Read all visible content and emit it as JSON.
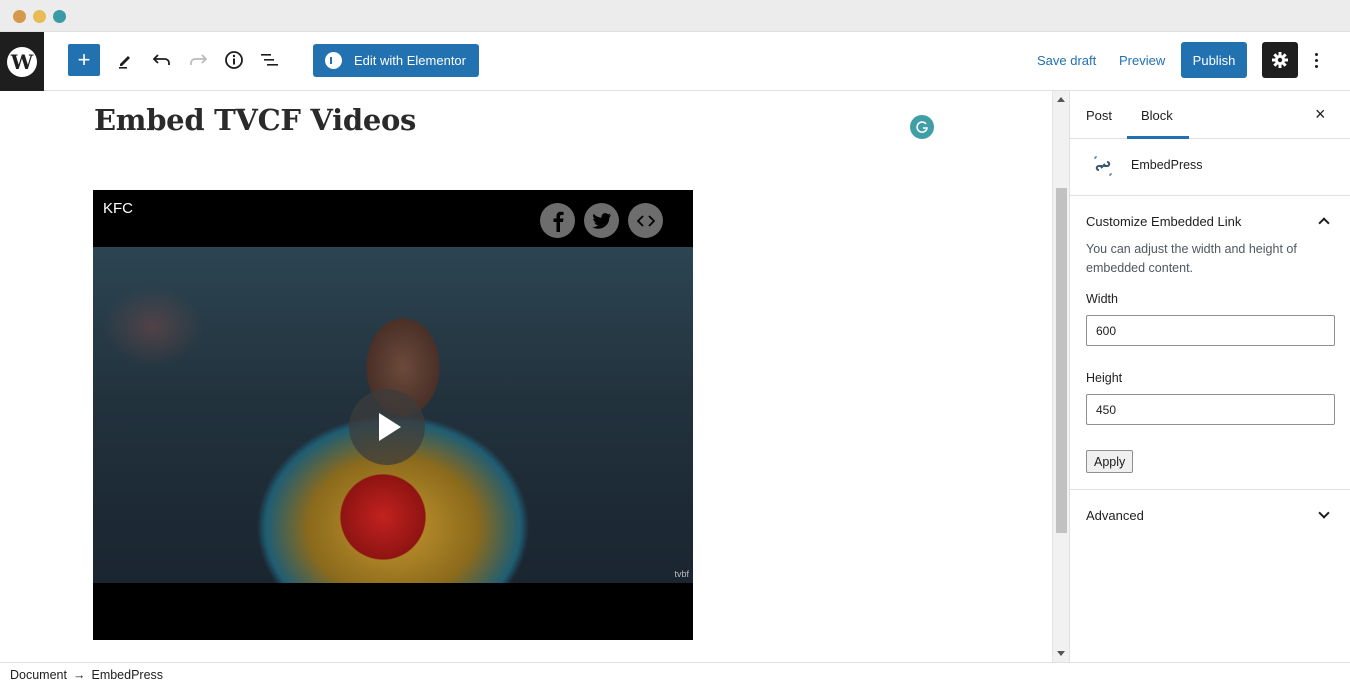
{
  "window": {
    "controls": [
      "close",
      "minimize",
      "maximize"
    ]
  },
  "toolbar": {
    "logo_icon": "wordpress-logo",
    "add_block_label": "+",
    "tools": [
      "pencil-icon",
      "undo-icon",
      "redo-icon",
      "info-icon",
      "list-view-icon"
    ],
    "elementor_label": "Edit with Elementor",
    "save_draft_label": "Save draft",
    "preview_label": "Preview",
    "publish_label": "Publish",
    "settings_icon": "gear-icon",
    "more_icon": "vertical-ellipsis-icon"
  },
  "editor": {
    "post_title": "Embed TVCF Videos",
    "embed": {
      "video_title": "KFC",
      "share_icons": [
        "facebook-icon",
        "twitter-icon",
        "embed-code-icon"
      ],
      "watermark": "tvbf",
      "play_icon": "play-icon"
    }
  },
  "sidebar": {
    "tabs": [
      {
        "label": "Post",
        "active": false
      },
      {
        "label": "Block",
        "active": true
      }
    ],
    "close_label": "×",
    "block_name": "EmbedPress",
    "panels": {
      "customize": {
        "title": "Customize Embedded Link",
        "expanded": true,
        "description": "You can adjust the width and height of embedded content.",
        "width_label": "Width",
        "width_value": "600",
        "height_label": "Height",
        "height_value": "450",
        "apply_label": "Apply"
      },
      "advanced": {
        "title": "Advanced",
        "expanded": false
      }
    }
  },
  "footer": {
    "breadcrumb": [
      "Document",
      "EmbedPress"
    ],
    "separator": "→"
  },
  "colors": {
    "accent": "#2271b1",
    "dark": "#1e1e1e",
    "grammarly": "#3f9ea6"
  }
}
